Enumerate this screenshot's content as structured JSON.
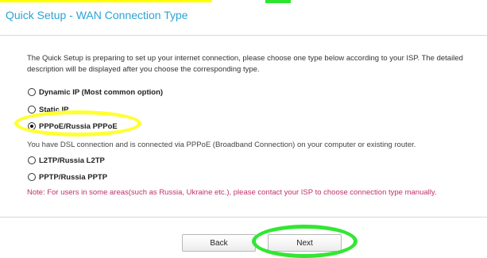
{
  "page": {
    "title": "Quick Setup - WAN Connection Type",
    "intro": "The Quick Setup is preparing to set up your internet connection, please choose one type below according to your ISP. The detailed description will be displayed after you choose the corresponding type."
  },
  "options": [
    {
      "label": "Dynamic IP (Most common option)",
      "selected": false
    },
    {
      "label": "Static IP",
      "selected": false
    },
    {
      "label": "PPPoE/Russia PPPoE",
      "selected": true
    },
    {
      "label": "L2TP/Russia L2TP",
      "selected": false
    },
    {
      "label": "PPTP/Russia PPTP",
      "selected": false
    }
  ],
  "description": "You have DSL connection and is connected via PPPoE (Broadband Connection) on your computer or existing router.",
  "note": "Note: For users in some areas(such as Russia, Ukraine etc.), please contact your ISP to choose connection type manually.",
  "buttons": {
    "back_label": "Back",
    "next_label": "Next"
  },
  "colors": {
    "title": "#2aa3d6",
    "note": "#c0306b",
    "highlight_yellow": "#ffff33",
    "highlight_green": "#33e633"
  }
}
